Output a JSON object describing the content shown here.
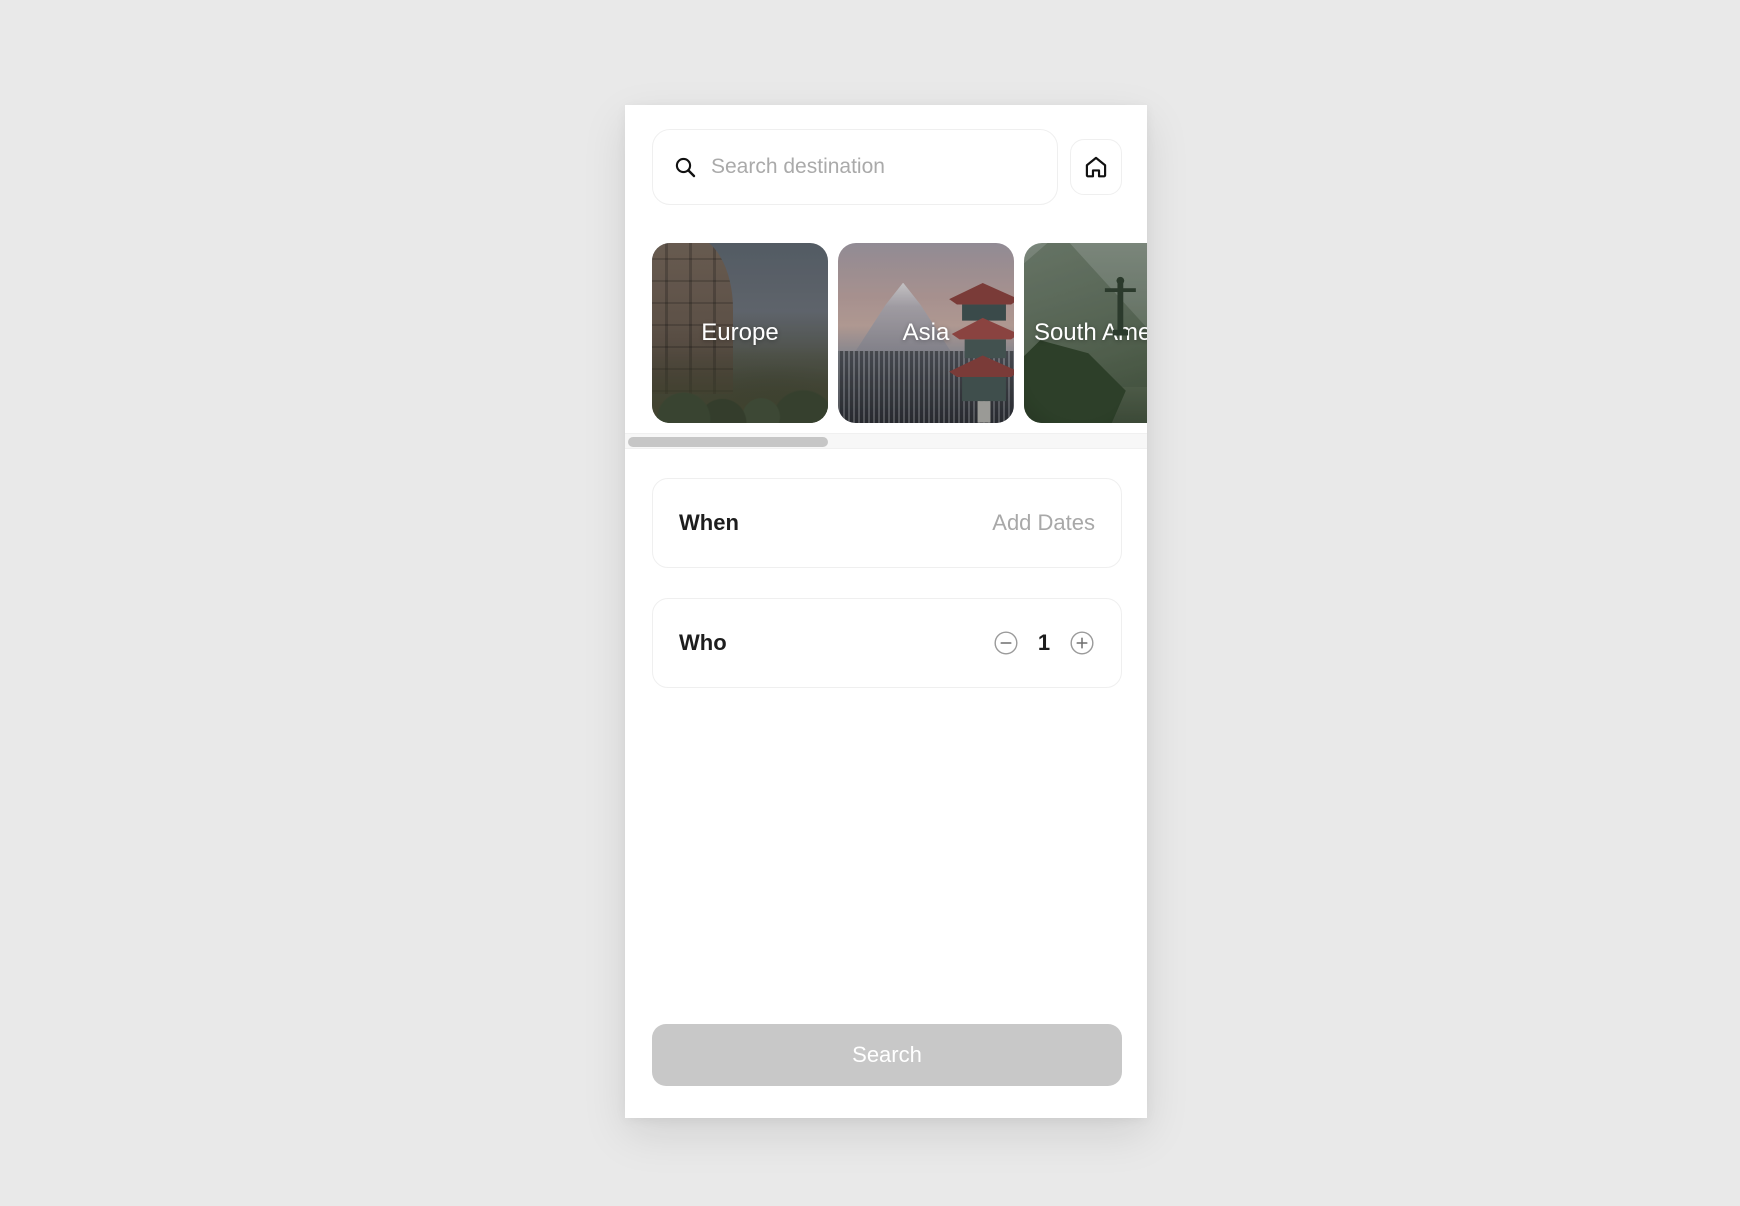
{
  "app": {
    "background_color": "#e9e9e9",
    "panel_color": "#ffffff"
  },
  "search": {
    "icon": "search-icon",
    "placeholder": "Search destination",
    "value": "",
    "home_button_icon": "home-icon"
  },
  "destinations": {
    "scroll_position": "left",
    "cards": [
      {
        "label": "Europe",
        "image": "colosseum-photo"
      },
      {
        "label": "Asia",
        "image": "mount-fuji-pagoda-photo"
      },
      {
        "label": "South America",
        "image": "christ-the-redeemer-photo"
      }
    ]
  },
  "options": {
    "when": {
      "label": "When",
      "value": "Add Dates"
    },
    "who": {
      "label": "Who",
      "count": "1",
      "decrement_icon": "minus-circle-icon",
      "increment_icon": "plus-circle-icon"
    }
  },
  "footer": {
    "search_label": "Search",
    "search_disabled_color": "#c8c8c8"
  }
}
